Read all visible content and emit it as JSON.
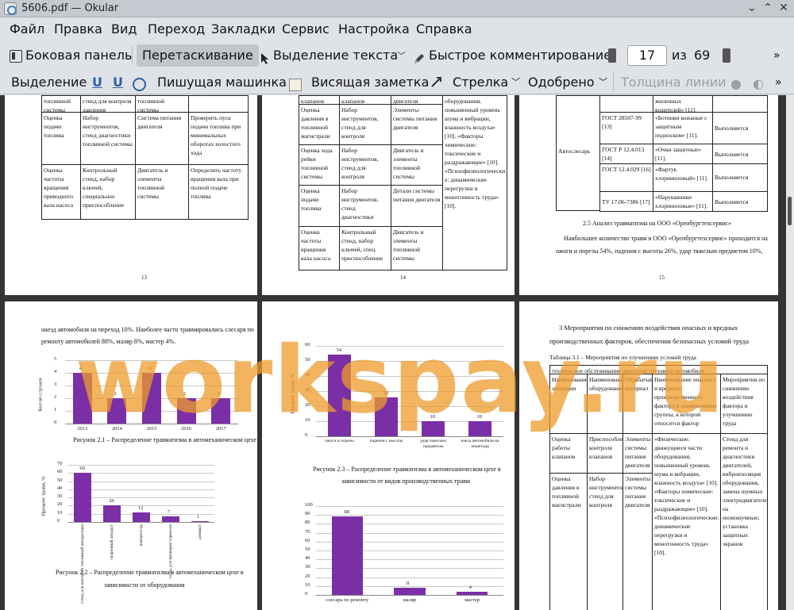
{
  "window": {
    "title": "5606.pdf — Okular"
  },
  "menu": [
    "Файл",
    "Правка",
    "Вид",
    "Переход",
    "Закладки",
    "Сервис",
    "Настройка",
    "Справка"
  ],
  "toolbar": {
    "sidebar": "Боковая панель",
    "drag": "Перетаскивание",
    "text_select": "Выделение текста",
    "quick_comment": "Быстрое комментирование",
    "page_value": "17",
    "of": "из",
    "total_pages": "69"
  },
  "annotation_bar": {
    "selection": "Выделение",
    "typewriter": "Пишущая машинка",
    "sticky_note": "Висящая заметка",
    "arrow": "Стрелка",
    "approved": "Одобрено",
    "line_width": "Толщина линии"
  },
  "watermark": "workspay.ru",
  "pages": {
    "p13": {
      "number": "13",
      "rows": [
        [
          "топливной системы",
          "стенд для контроля давления",
          "топливной системы",
          ""
        ],
        [
          "Оценка подачи топлива",
          "Набор инструментов, стенд диагностики топливной системы",
          "Система питания двигателя",
          "Проверить пуск подачи топлива при минимальных оборотах холостого хода"
        ],
        [
          "Оценка частоты вращения приводного вала насоса",
          "Контрольный стенд, набор ключей, специальное приспособление",
          "Двигатель и элементы топливной системы",
          "Определить частоту вращения вала при полной подаче топлива"
        ]
      ]
    },
    "p14": {
      "number": "14",
      "rows": [
        [
          "клапанов",
          "клапанов",
          "двигателя",
          ""
        ],
        [
          "Оценка давления в топливной магистрали",
          "Набор инструментов, стенд для контроля",
          "Элементы системы питания двигателя",
          ""
        ],
        [
          "Оценка хода рейки топливной системы",
          "Набор инструментов, стенд для контроля",
          "Двигатель и элементы топливной системы",
          ""
        ],
        [
          "Оценка подачи топлива",
          "Набор инструментов, стенд диагностики",
          "Детали системы питания двигателя",
          ""
        ],
        [
          "Оценка частоты вращения вала насоса",
          "Контрольный стенд, набор ключей, спец. приспособление",
          "Двигатель и элементы топливной системы",
          ""
        ]
      ],
      "side_text": "оборудования, повышенный уровень шума и вибрации, влажность воздуха» [10]. «Факторы химические: токсические и раздражающие» [10]. «Психофизиологически е: динамические перегрузки и монотонность труда» [10]."
    },
    "p15": {
      "number": "15",
      "role": "Автослесарь",
      "rows": [
        [
          "",
          "жиленных водителей» [11].",
          ""
        ],
        [
          "ГОСТ 28507-99 [13]",
          "«Ботинки кожаные с защитным подноском» [11].",
          "Выполняется"
        ],
        [
          "ГОСТ Р 12.4.013 [14]",
          "«Очки защитные» [11].",
          "Выполняется"
        ],
        [
          "ГОСТ 12.4.029 [16]",
          "«Фартук хлориниловый» [11].",
          "Выполняется"
        ],
        [
          "ТУ 17.06-7386 [17]",
          "«Нарукавники хлориниловые» [11].",
          "Выполняется"
        ]
      ],
      "heading": "2.5 Анализ травматизма на ООО «Оренбургтехсервис»",
      "para1": "Наибольшее количество травм в ООО «Оренбургтехсервис» приходится на",
      "para2": "ожоги и порезы 54%, падения с высоты 26%, удар тяжелым предметом 10%,"
    },
    "p16": {
      "line1": "наезд автомобиля на переход 10%. Наиболее часто травмировались слесаря по",
      "line2": "ремонту автомобилей 88%, маляр 8%, мастер 4%.",
      "fig1_caption": "Рисунок 2.1 – Распределение травматизма в автомеханическом цехе",
      "fig2_caption1": "Рисунок 2.2 – Распределение травматизма в автомеханическом цехе в",
      "fig2_caption2": "зависимости от оборудования"
    },
    "p17": {
      "fig3_caption1": "Рисунок 2.3 – Распределение травматизма в автомеханическом цехе в",
      "fig3_caption2": "зависимости от видов производственных травм"
    },
    "p18": {
      "heading1": "3 Мероприятия по снижению воздействия опасных и вредных",
      "heading2": "производственных факторов, обеспечения безопасных условий труда",
      "table_title": "Таблица 3.1 – Мероприятия по улучшению условий труда",
      "table_subtitle": "техническое обслуживание двигателя грузового автомобиля",
      "headers": [
        "Наименование операции",
        "Наименование оборудования",
        "Обрабатываемый материал",
        "Наименование опасного и вредного производственного фактора и наименование группы, к которой относится фактор",
        "Мероприятия по снижению воздействия фактора и улучшению труда"
      ],
      "rows": [
        [
          "Оценка работы клапанов",
          "Приспособление контроля клапанов",
          "Элементы системы питания двигателя",
          "«Физические: движущиеся части оборудования, повышенный уровень шума и вибрации, влажность воздуха» [10]. «Факторы химические: токсические и раздражающие» [10]. «Психофизиологические: динамические перегрузки и монотонность труда» [10].",
          "Стенд для ремонта и диагностики двигателей, виброизоляция оборудования, замена шумных электродвигателей на низкошумные, установка защитных экранов"
        ],
        [
          "Оценка давления в топливной магистрали",
          "Набор инструментов, стенд для контроля",
          "Элементы системы питания двигателя",
          "",
          ""
        ]
      ]
    }
  },
  "chart_data": [
    {
      "type": "bar",
      "categories": [
        "2013",
        "2014",
        "2015",
        "2016",
        "2017"
      ],
      "values": [
        4,
        2,
        4,
        2,
        2
      ],
      "ylabel": "Кол-во случаев",
      "ylim": [
        0,
        5
      ],
      "yticks": [
        "5",
        "4",
        "3",
        "2",
        "1",
        "0"
      ],
      "color": "#7b2fa6"
    },
    {
      "type": "bar",
      "categories": [
        "стенд для контроля топливной аппаратуры",
        "сварочный аппарат",
        "компрессор",
        "стенд для проверки тормозов",
        "домкрат"
      ],
      "values": [
        60,
        20,
        12,
        7,
        1
      ],
      "ylabel": "Процент травм, %",
      "ylim": [
        0,
        70
      ],
      "yticks": [
        "70",
        "60",
        "50",
        "40",
        "30",
        "20",
        "10",
        "0"
      ],
      "color": "#7b2fa6"
    },
    {
      "type": "bar",
      "categories": [
        "ожоги и порезы",
        "падения с высоты",
        "удар тяжелым предметом",
        "наезд автомобиля на пешехода"
      ],
      "values": [
        54,
        26,
        10,
        10
      ],
      "ylabel": "Процент травм, %",
      "ylim": [
        0,
        60
      ],
      "yticks": [
        "60",
        "50",
        "40",
        "30",
        "20",
        "10",
        "0"
      ],
      "color": "#7b2fa6"
    },
    {
      "type": "bar",
      "categories": [
        "слесарь по ремонту",
        "маляр",
        "мастер"
      ],
      "values": [
        88,
        8,
        4
      ],
      "ylim": [
        0,
        100
      ],
      "yticks": [
        "100",
        "90",
        "80",
        "70",
        "60",
        "50",
        "40",
        "30",
        "20",
        "10",
        "0"
      ],
      "color": "#7b2fa6"
    }
  ]
}
